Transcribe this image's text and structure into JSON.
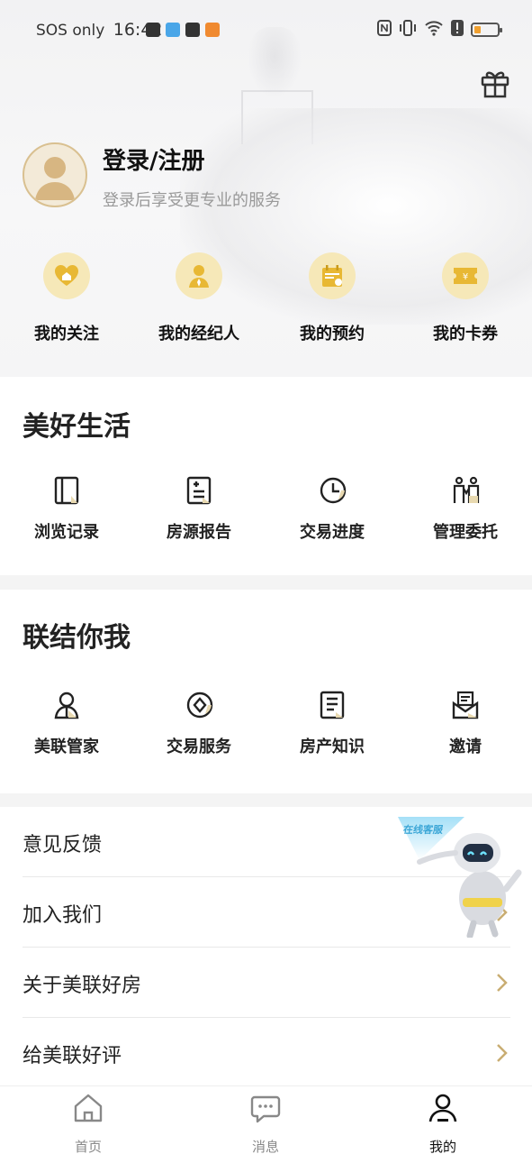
{
  "status_bar": {
    "carrier": "SOS only",
    "time": "16:42"
  },
  "profile": {
    "login_title": "登录/注册",
    "login_subtitle": "登录后享受更专业的服务"
  },
  "quick_actions": [
    {
      "label": "我的关注",
      "icon": "heart-house-icon"
    },
    {
      "label": "我的经纪人",
      "icon": "agent-icon"
    },
    {
      "label": "我的预约",
      "icon": "calendar-icon"
    },
    {
      "label": "我的卡券",
      "icon": "coupon-icon"
    }
  ],
  "life_section": {
    "title": "美好生活",
    "items": [
      {
        "label": "浏览记录",
        "icon": "book-icon"
      },
      {
        "label": "房源报告",
        "icon": "report-icon"
      },
      {
        "label": "交易进度",
        "icon": "clock-icon"
      },
      {
        "label": "管理委托",
        "icon": "people-icon"
      }
    ]
  },
  "connect_section": {
    "title": "联结你我",
    "items": [
      {
        "label": "美联管家",
        "icon": "butler-icon"
      },
      {
        "label": "交易服务",
        "icon": "diamond-icon"
      },
      {
        "label": "房产知识",
        "icon": "document-icon"
      },
      {
        "label": "邀请",
        "icon": "envelope-icon"
      }
    ]
  },
  "list": [
    {
      "label": "意见反馈"
    },
    {
      "label": "加入我们"
    },
    {
      "label": "关于美联好房"
    },
    {
      "label": "给美联好评"
    }
  ],
  "robot_badge": "在线客服",
  "tabs": [
    {
      "label": "首页",
      "icon": "home-icon"
    },
    {
      "label": "消息",
      "icon": "message-icon"
    },
    {
      "label": "我的",
      "icon": "user-icon"
    }
  ],
  "colors": {
    "accent_gold": "#d9b86a",
    "icon_bg": "#f6e8b8",
    "text_dark": "#222222",
    "text_muted": "#999999"
  }
}
